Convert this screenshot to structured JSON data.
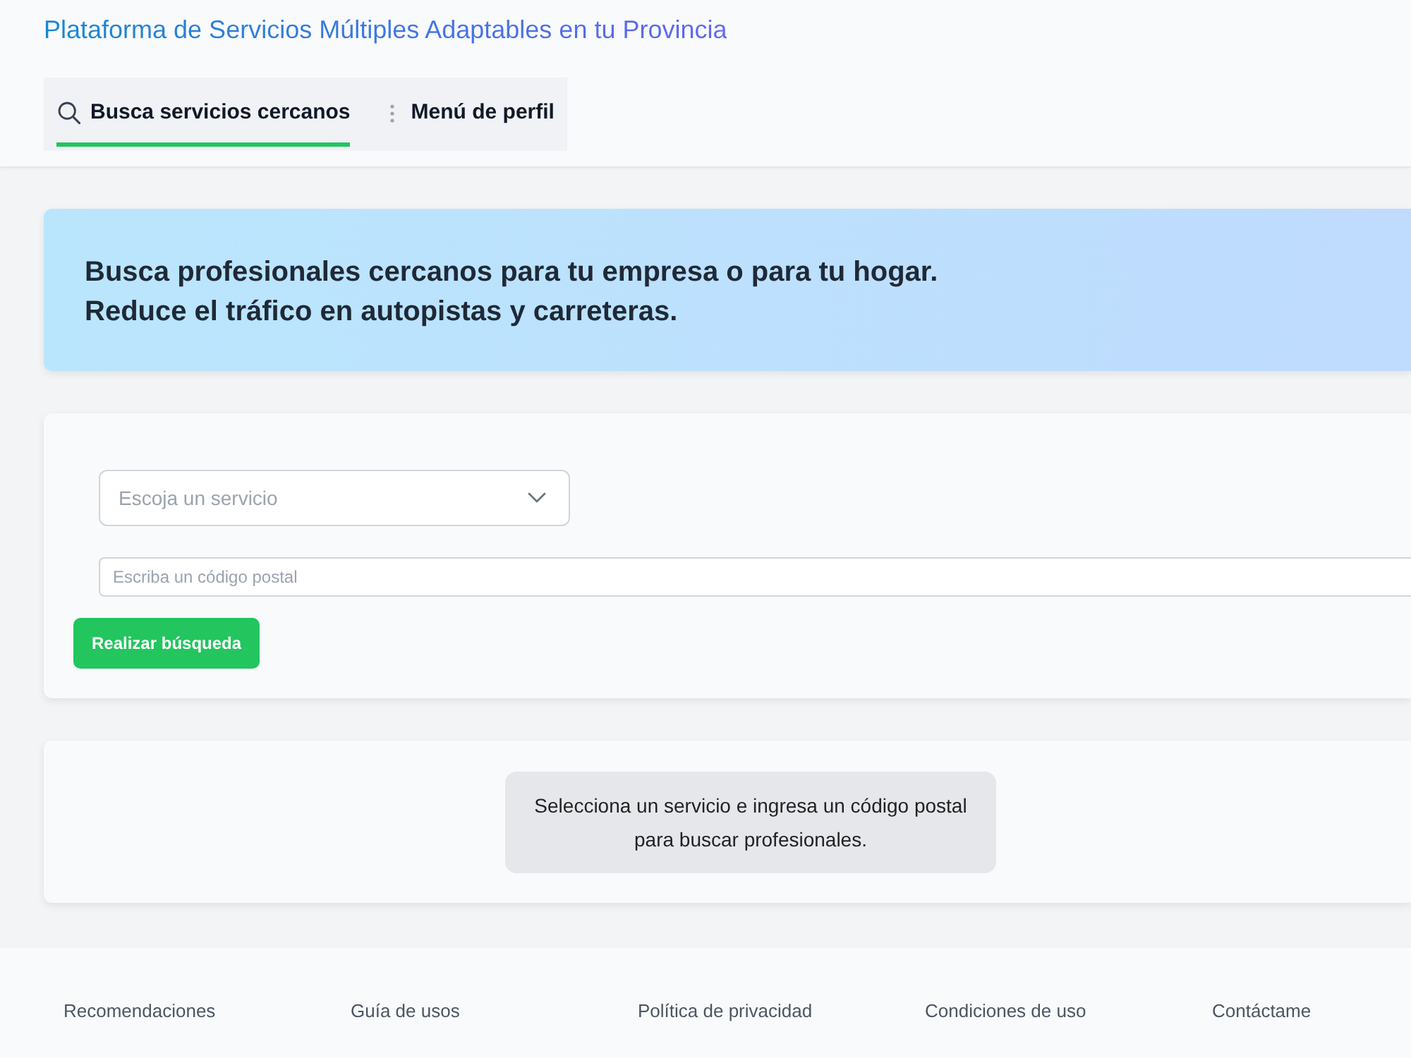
{
  "header": {
    "title": "Plataforma de Servicios Múltiples Adaptables en tu Provincia",
    "tabs": [
      {
        "kind": "search",
        "label": "Busca servicios cercanos",
        "selected": true
      },
      {
        "kind": "menu",
        "label": "Menú de perfil",
        "selected": false
      }
    ]
  },
  "banner": {
    "lines": [
      "Busca profesionales cercanos para tu empresa o para tu hogar.",
      "Reduce el tráfico en autopistas y carreteras."
    ]
  },
  "search_form": {
    "service_select": {
      "placeholder": "Escoja un servicio"
    },
    "postal_code": {
      "placeholder": "Escriba un código postal"
    },
    "submit_button": "Realizar búsqueda"
  },
  "results": {
    "message": "Selecciona un servicio e ingresa un código postal para buscar profesionales."
  },
  "footer": {
    "links": [
      "Recomendaciones",
      "Guía de usos",
      "Política de privacidad",
      "Condiciones de uso",
      "Contáctame"
    ]
  }
}
